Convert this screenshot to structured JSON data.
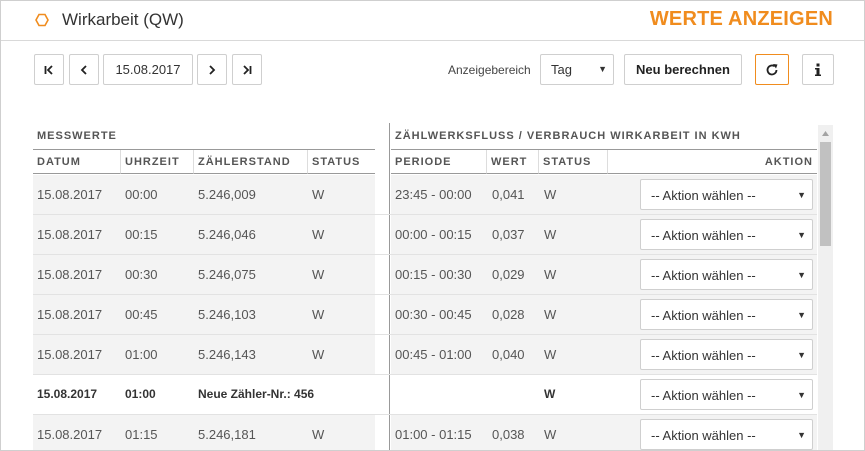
{
  "header": {
    "title": "Wirkarbeit (QW)",
    "action_title": "WERTE ANZEIGEN",
    "accent_color": "#f08c1e"
  },
  "toolbar": {
    "date": "15.08.2017",
    "range_label": "Anzeigebereich",
    "range_value": "Tag",
    "recalc_label": "Neu berechnen"
  },
  "table": {
    "group_left": "MESSWERTE",
    "group_right": "ZÄHLWERKSFLUSS / VERBRAUCH WIRKARBEIT IN KWH",
    "headers": {
      "datum": "DATUM",
      "uhrzeit": "UHRZEIT",
      "zaehlerstand": "ZÄHLERSTAND",
      "status_left": "STATUS",
      "periode": "PERIODE",
      "wert": "WERT",
      "status_right": "STATUS",
      "aktion": "AKTION"
    },
    "action_placeholder": "-- Aktion wählen --",
    "rows": [
      {
        "datum": "15.08.2017",
        "uhrzeit": "00:00",
        "zaehlerstand": "5.246,009",
        "status": "W",
        "periode": "23:45 - 00:00",
        "wert": "0,041",
        "status2": "W"
      },
      {
        "datum": "15.08.2017",
        "uhrzeit": "00:15",
        "zaehlerstand": "5.246,046",
        "status": "W",
        "periode": "00:00 - 00:15",
        "wert": "0,037",
        "status2": "W"
      },
      {
        "datum": "15.08.2017",
        "uhrzeit": "00:30",
        "zaehlerstand": "5.246,075",
        "status": "W",
        "periode": "00:15 - 00:30",
        "wert": "0,029",
        "status2": "W"
      },
      {
        "datum": "15.08.2017",
        "uhrzeit": "00:45",
        "zaehlerstand": "5.246,103",
        "status": "W",
        "periode": "00:30 - 00:45",
        "wert": "0,028",
        "status2": "W"
      },
      {
        "datum": "15.08.2017",
        "uhrzeit": "01:00",
        "zaehlerstand": "5.246,143",
        "status": "W",
        "periode": "00:45 - 01:00",
        "wert": "0,040",
        "status2": "W"
      },
      {
        "datum": "15.08.2017",
        "uhrzeit": "01:00",
        "zaehlerstand": "Neue Zähler-Nr.: 456",
        "status": "",
        "periode": "",
        "wert": "",
        "status2": "W"
      },
      {
        "datum": "15.08.2017",
        "uhrzeit": "01:15",
        "zaehlerstand": "5.246,181",
        "status": "W",
        "periode": "01:00 - 01:15",
        "wert": "0,038",
        "status2": "W"
      }
    ]
  }
}
